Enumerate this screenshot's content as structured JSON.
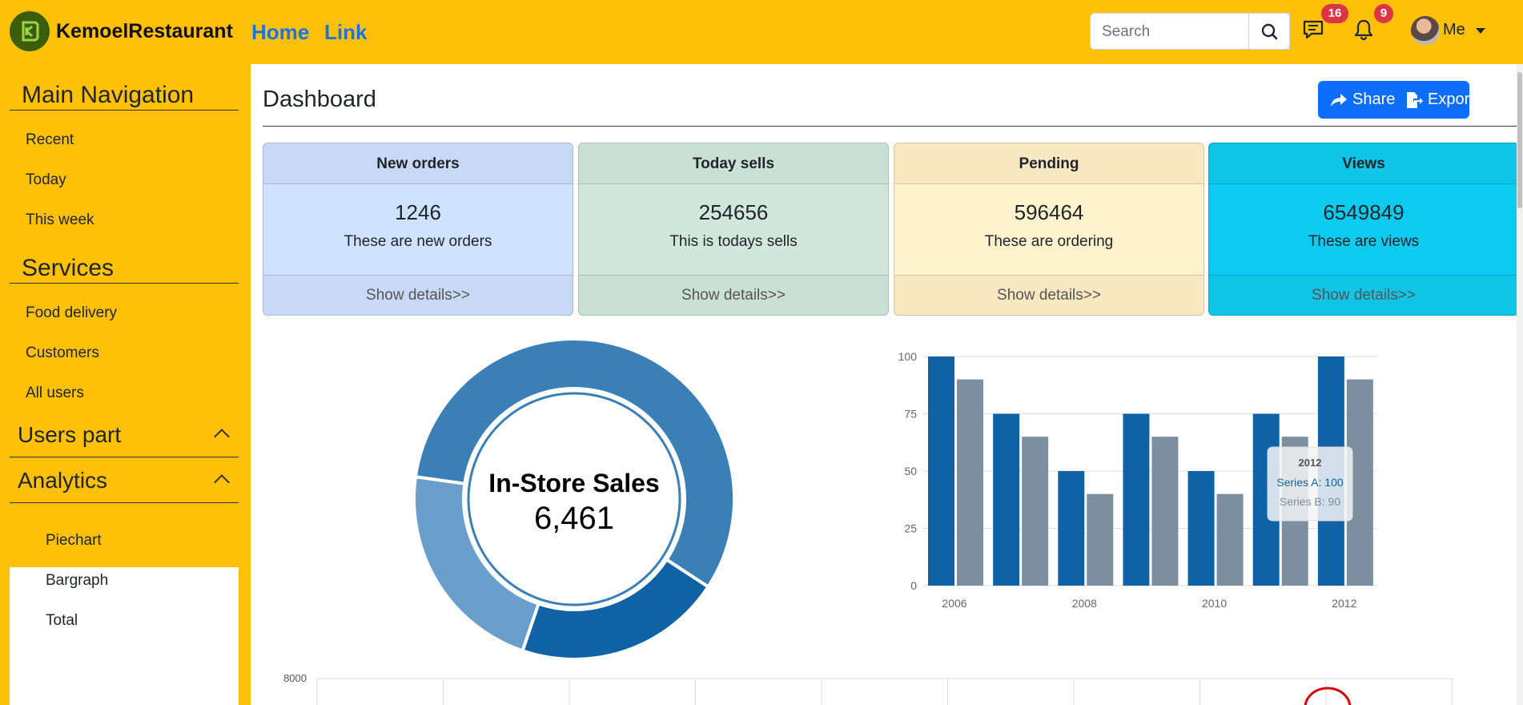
{
  "navbar": {
    "brand": "KemoelRestaurant",
    "links": [
      "Home",
      "Link"
    ],
    "search_placeholder": "Search",
    "messages_count": "16",
    "notifications_count": "9",
    "user_label": "Me"
  },
  "sidebar": {
    "main_nav_heading": "Main Navigation",
    "main_nav_items": [
      "Recent",
      "Today",
      "This week"
    ],
    "services_heading": "Services",
    "services_items": [
      "Food delivery",
      "Customers",
      "All users"
    ],
    "users_part": "Users part",
    "analytics": "Analytics",
    "analytics_items": [
      "Piechart",
      "Bargraph",
      "Total"
    ]
  },
  "main": {
    "title": "Dashboard",
    "share_label": "Share",
    "export_label": "Export",
    "cards": [
      {
        "title": "New orders",
        "value": "1246",
        "text": "These are new orders",
        "footer": "Show details>>",
        "header_bg": "#c8d9f6",
        "body_bg": "#cfe2ff"
      },
      {
        "title": "Today sells",
        "value": "254656",
        "text": "This is todays sells",
        "footer": "Show details>>",
        "header_bg": "#c9e0d7",
        "body_bg": "#d1e7dd"
      },
      {
        "title": "Pending",
        "value": "596464",
        "text": "These are ordering",
        "footer": "Show details>>",
        "header_bg": "#f7e8c1",
        "body_bg": "#fff3cd"
      },
      {
        "title": "Views",
        "value": "6549849",
        "text": "These are views",
        "footer": "Show details>>",
        "header_bg": "#0fc5e7",
        "body_bg": "#0dcaf0"
      }
    ]
  },
  "chart_data": [
    {
      "type": "pie",
      "center_title": "In-Store Sales",
      "center_value": "6,461",
      "slices": [
        {
          "value": 57,
          "color": "#3a7fb5"
        },
        {
          "value": 21,
          "color": "#0f62a6"
        },
        {
          "value": 22,
          "color": "#6a9fcb"
        }
      ]
    },
    {
      "type": "bar",
      "categories": [
        "2006",
        "2007",
        "2008",
        "2009",
        "2010",
        "2011",
        "2012"
      ],
      "x_tick_labels": [
        "2006",
        "2008",
        "2010",
        "2012"
      ],
      "series": [
        {
          "name": "Series A",
          "values": [
            100,
            75,
            50,
            75,
            50,
            75,
            100
          ],
          "color": "#0f62a6"
        },
        {
          "name": "Series B",
          "values": [
            90,
            65,
            40,
            65,
            40,
            65,
            90
          ],
          "color": "#7b8fa1"
        }
      ],
      "ylim": [
        0,
        100
      ],
      "y_ticks": [
        "0",
        "25",
        "50",
        "75",
        "100"
      ],
      "grid": true,
      "tooltip": {
        "title": "2012",
        "line_a": "Series A: 100",
        "line_b": "Series B: 90"
      }
    },
    {
      "type": "line",
      "y_tick_visible": "8000"
    }
  ]
}
